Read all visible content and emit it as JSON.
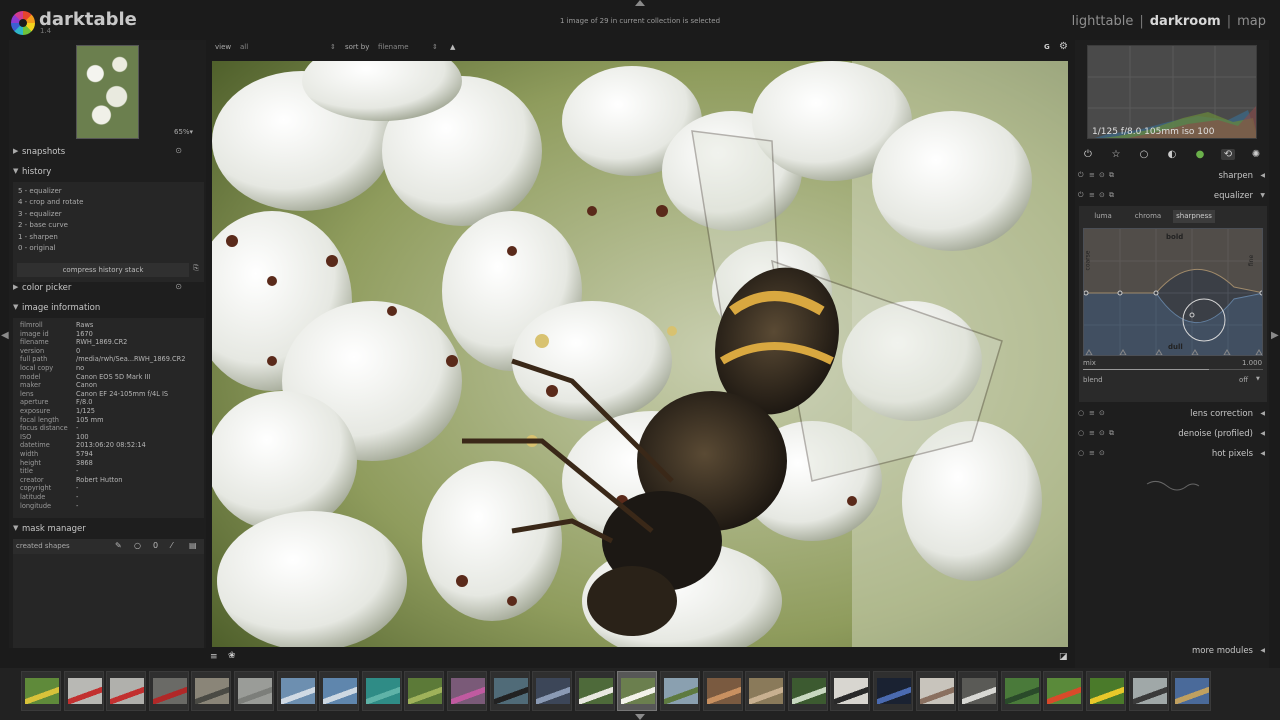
{
  "app": {
    "name": "darktable",
    "version": "1.4",
    "logo_icon": "darktable-aperture-logo"
  },
  "status": {
    "collection": "1 image of 29 in current collection is selected"
  },
  "views": {
    "lighttable": "lighttable",
    "darkroom": "darkroom",
    "map": "map",
    "separator": "|",
    "active": "darkroom"
  },
  "toolbar": {
    "view_label": "view",
    "view_value": "all",
    "sort_label": "sort by",
    "sort_value": "filename",
    "group_label": "G",
    "settings_icon": "gear-icon"
  },
  "navigation": {
    "zoom": "65%▾"
  },
  "left": {
    "snapshots": "snapshots",
    "history": {
      "title": "history",
      "items": [
        "5 - equalizer",
        "4 - crop and rotate",
        "3 - equalizer",
        "2 - base curve",
        "1 - sharpen",
        "0 - original"
      ],
      "compress": "compress history stack"
    },
    "color_picker": "color picker",
    "image_information": {
      "title": "image information",
      "rows": [
        {
          "k": "filmroll",
          "v": "Raws"
        },
        {
          "k": "image id",
          "v": "1670"
        },
        {
          "k": "filename",
          "v": "RWH_1869.CR2"
        },
        {
          "k": "version",
          "v": "0"
        },
        {
          "k": "full path",
          "v": "/media/rwh/Sea...RWH_1869.CR2"
        },
        {
          "k": "local copy",
          "v": "no"
        },
        {
          "k": "model",
          "v": "Canon EOS 5D Mark III"
        },
        {
          "k": "maker",
          "v": "Canon"
        },
        {
          "k": "lens",
          "v": "Canon EF 24-105mm f/4L IS"
        },
        {
          "k": "aperture",
          "v": "F/8.0"
        },
        {
          "k": "exposure",
          "v": "1/125"
        },
        {
          "k": "focal length",
          "v": "105 mm"
        },
        {
          "k": "focus distance",
          "v": "-"
        },
        {
          "k": "ISO",
          "v": "100"
        },
        {
          "k": "datetime",
          "v": "2013:06:20 08:52:14"
        },
        {
          "k": "width",
          "v": "5794"
        },
        {
          "k": "height",
          "v": "3868"
        },
        {
          "k": "title",
          "v": "-"
        },
        {
          "k": "creator",
          "v": "Robert Hutton"
        },
        {
          "k": "copyright",
          "v": "-"
        },
        {
          "k": "latitude",
          "v": "-"
        },
        {
          "k": "longitude",
          "v": "-"
        }
      ]
    },
    "mask_manager": {
      "title": "mask manager",
      "created_shapes": "created shapes",
      "tool_zero": "0"
    }
  },
  "right": {
    "histogram_info": "1/125 f/8.0 105mm iso 100",
    "module_groups": [
      "power-icon",
      "star-icon",
      "circle-icon",
      "half-circle-icon",
      "color-icon",
      "correct-icon",
      "effect-icon"
    ],
    "modules": {
      "sharpen": "sharpen",
      "equalizer": "equalizer",
      "lens_correction": "lens correction",
      "denoise": "denoise (profiled)",
      "hot_pixels": "hot pixels"
    },
    "equalizer": {
      "tabs": [
        "luma",
        "chroma",
        "sharpness"
      ],
      "active_tab": "sharpness",
      "graph_labels": {
        "top": "bold",
        "bottom": "dull",
        "left": "coarse",
        "right": "fine"
      },
      "mix_label": "mix",
      "mix_value": "1.000",
      "mix_fraction": 0.7,
      "blend_label": "blend",
      "blend_value": "off"
    },
    "more_modules": "more modules"
  },
  "filmstrip": {
    "selected_index": 14,
    "thumbs": [
      {
        "color": "#5f8a3a",
        "accent": "#d8c23a",
        "name": "field-thumb"
      },
      {
        "color": "#b8b8b4",
        "accent": "#c23030",
        "name": "phonebox-thumb"
      },
      {
        "color": "#b0b0ac",
        "accent": "#c23030",
        "name": "phonebox-thumb"
      },
      {
        "color": "#6a6a66",
        "accent": "#b02828",
        "name": "phonebox-thumb"
      },
      {
        "color": "#8a8578",
        "accent": "#4a4a44",
        "name": "beach-thumb"
      },
      {
        "color": "#9a9c98",
        "accent": "#7c7e7a",
        "name": "fog-thumb"
      },
      {
        "color": "#6d8fb0",
        "accent": "#d0dae4",
        "name": "sky-thumb"
      },
      {
        "color": "#5f86ad",
        "accent": "#cdd8e2",
        "name": "sky-thumb"
      },
      {
        "color": "#2f8c86",
        "accent": "#5fb3a8",
        "name": "water-thumb"
      },
      {
        "color": "#5c7a38",
        "accent": "#9fb25a",
        "name": "grass-thumb"
      },
      {
        "color": "#7a5a78",
        "accent": "#c05aa0",
        "name": "flower-thumb"
      },
      {
        "color": "#506b78",
        "accent": "#222222",
        "name": "landscape-thumb"
      },
      {
        "color": "#3c4658",
        "accent": "#8a9ab4",
        "name": "street-thumb"
      },
      {
        "color": "#4e6a3a",
        "accent": "#e8e8e0",
        "name": "portrait-thumb"
      },
      {
        "color": "#6b7f4e",
        "accent": "#f2f2ea",
        "name": "bee-thumb"
      },
      {
        "color": "#8aa0b0",
        "accent": "#5e7a40",
        "name": "field-thumb"
      },
      {
        "color": "#7a5a40",
        "accent": "#c89060",
        "name": "food-thumb"
      },
      {
        "color": "#8a7a5a",
        "accent": "#c8b090",
        "name": "building-thumb"
      },
      {
        "color": "#3c5a30",
        "accent": "#c8d8c0",
        "name": "plant-thumb"
      },
      {
        "color": "#d8d6d0",
        "accent": "#2a2a2a",
        "name": "portrait-thumb"
      },
      {
        "color": "#1a2232",
        "accent": "#4a6ab0",
        "name": "night-thumb"
      },
      {
        "color": "#c8c4bc",
        "accent": "#8a7060",
        "name": "portrait-thumb"
      },
      {
        "color": "#5a5a56",
        "accent": "#d8d8d4",
        "name": "flower-thumb"
      },
      {
        "color": "#4a7a3a",
        "accent": "#2a4a2a",
        "name": "tree-thumb"
      },
      {
        "color": "#5a8a3a",
        "accent": "#d84a2a",
        "name": "tulip-thumb"
      },
      {
        "color": "#4a7a2a",
        "accent": "#e8c82a",
        "name": "yellow-flower-thumb"
      },
      {
        "color": "#a0a8a8",
        "accent": "#3a3a3a",
        "name": "bridge-thumb"
      },
      {
        "color": "#4a6a9a",
        "accent": "#c0a060",
        "name": "castle-thumb"
      }
    ]
  }
}
